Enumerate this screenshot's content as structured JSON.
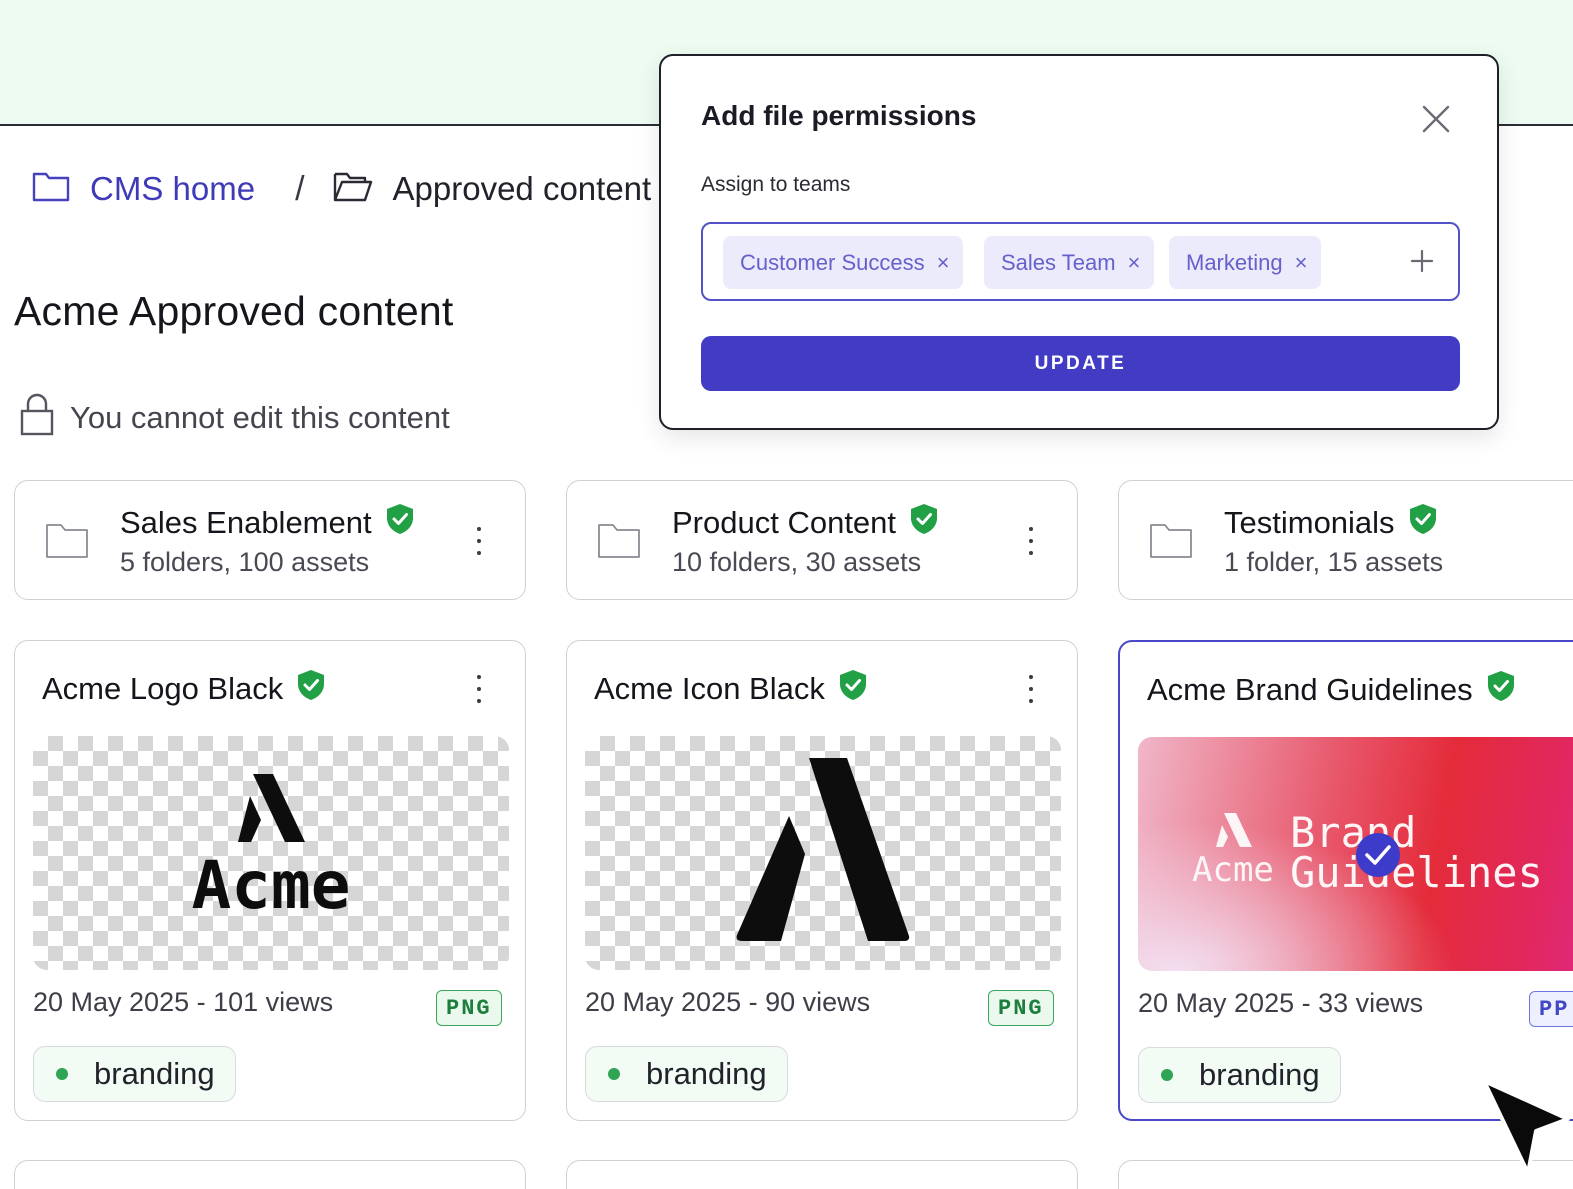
{
  "breadcrumb": {
    "home_label": "CMS home",
    "separator": "/",
    "current_label": "Approved content"
  },
  "page": {
    "title": "Acme Approved content",
    "lock_notice": "You cannot edit this content"
  },
  "folders": [
    {
      "name": "Sales Enablement",
      "meta": "5 folders, 100 assets",
      "verified": true
    },
    {
      "name": "Product Content",
      "meta": "10 folders, 30 assets",
      "verified": true
    },
    {
      "name": "Testimonials",
      "meta": "1 folder, 15 assets",
      "verified": true
    }
  ],
  "assets": [
    {
      "title": "Acme Logo Black",
      "meta": "20 May 2025 - 101 views",
      "format": "PNG",
      "tag": "branding",
      "thumb_text": "Acme"
    },
    {
      "title": "Acme Icon Black",
      "meta": "20 May 2025 - 90 views",
      "format": "PNG",
      "tag": "branding"
    },
    {
      "title": "Acme Brand Guidelines",
      "meta": "20 May 2025 - 33 views",
      "format": "PP",
      "tag": "branding",
      "selected": true,
      "thumb_logo_text": "Acme",
      "thumb_line1": "Brand",
      "thumb_line2": "Guidelines"
    }
  ],
  "modal": {
    "title": "Add file permissions",
    "assign_label": "Assign to teams",
    "teams": [
      "Customer Success",
      "Sales Team",
      "Marketing"
    ],
    "chip_remove_glyph": "×",
    "update_label": "UPDATE"
  },
  "colors": {
    "accent": "#423bc4",
    "topbar_bg": "#edfbf1",
    "verified_green": "#22a045",
    "tag_dot": "#2fa455"
  },
  "icons": {
    "breadcrumb_home": "folder-icon",
    "breadcrumb_current": "folder-open-icon",
    "lock": "lock-icon",
    "verified": "verified-shield-icon",
    "more": "more-vertical-icon",
    "close": "close-icon",
    "add": "plus-icon",
    "cursor": "mouse-pointer-icon"
  }
}
